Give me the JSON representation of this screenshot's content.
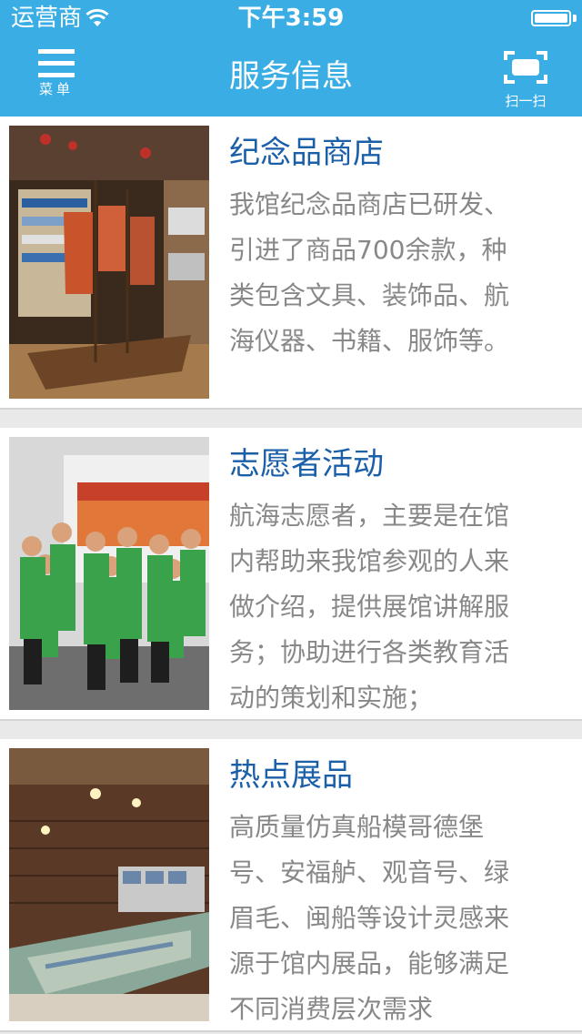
{
  "status_bar": {
    "carrier": "运营商",
    "time": "下午3:59"
  },
  "nav": {
    "title": "服务信息",
    "menu_label": "菜单",
    "scan_label": "扫一扫"
  },
  "items": [
    {
      "title": "纪念品商店",
      "description": "我馆纪念品商店已研发、\n引进了商品700余款，种\n类包含文具、装饰品、航\n海仪器、书籍、服饰等。"
    },
    {
      "title": "志愿者活动",
      "description": "航海志愿者，主要是在馆\n内帮助来我馆参观的人来\n做介绍，提供展馆讲解服\n务；协助进行各类教育活\n动的策划和实施；"
    },
    {
      "title": "热点展品",
      "description": "高质量仿真船模哥德堡\n号、安福舻、观音号、绿\n眉毛、闽船等设计灵感来\n源于馆内展品，能够满足\n不同消费层次需求"
    }
  ]
}
